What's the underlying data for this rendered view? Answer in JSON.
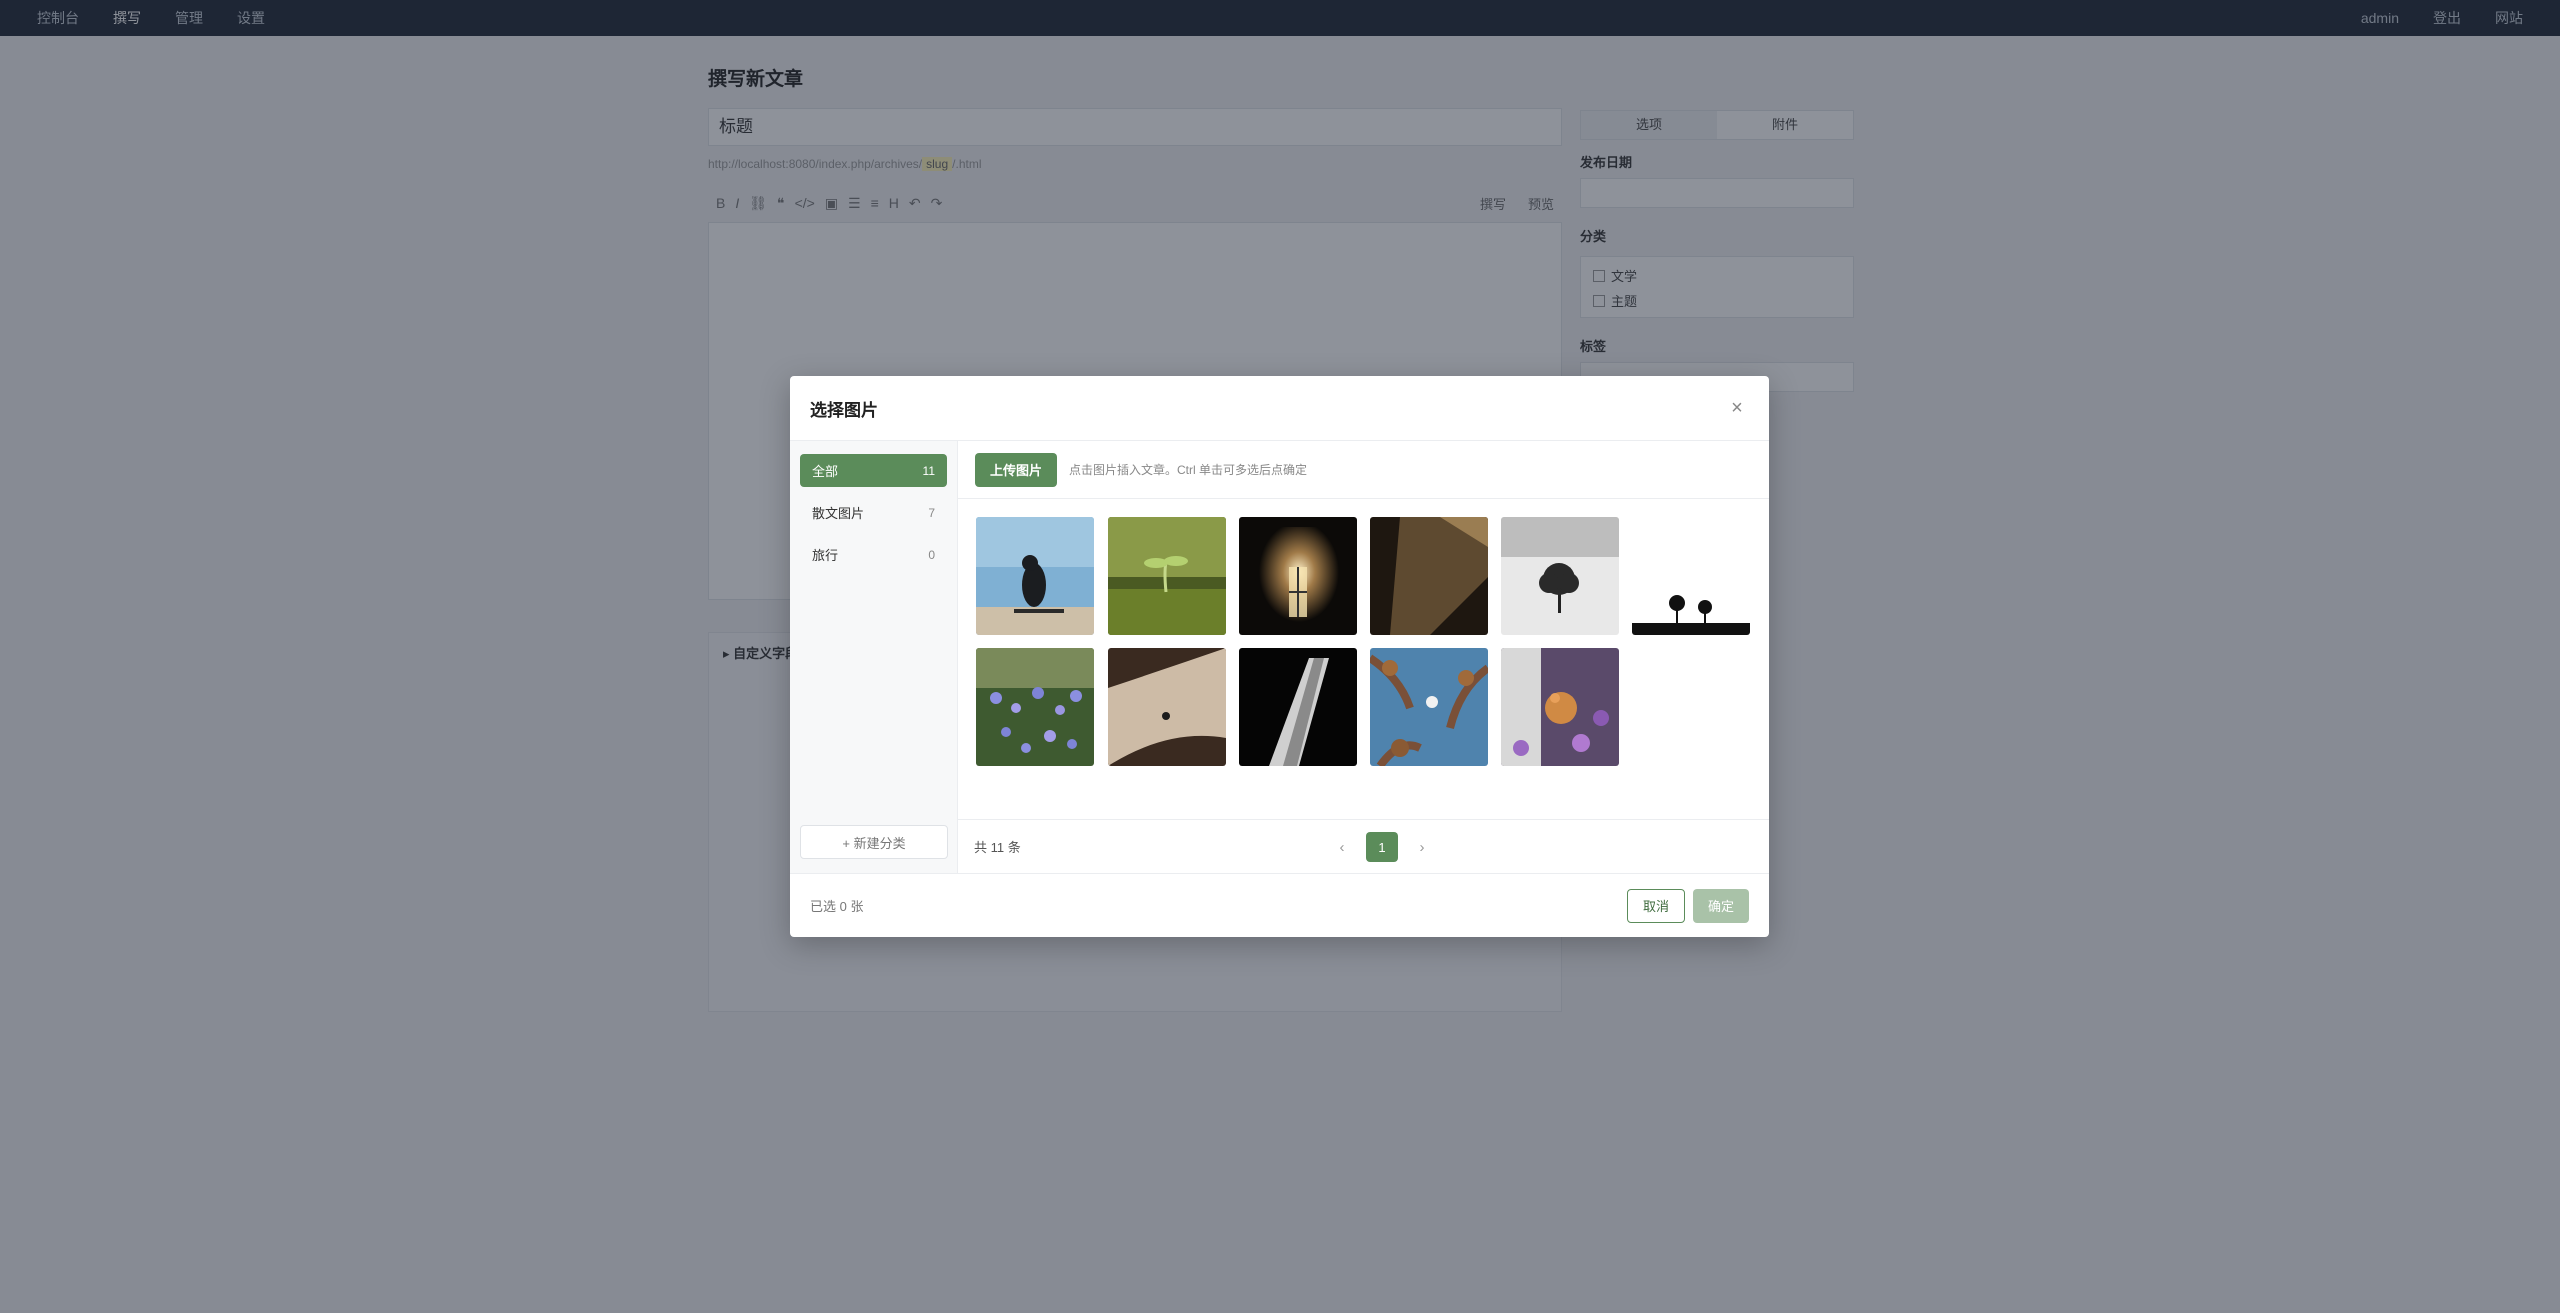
{
  "topnav": {
    "left": [
      "控制台",
      "撰写",
      "管理",
      "设置"
    ],
    "active_index": 1,
    "right": [
      "admin",
      "登出",
      "网站"
    ]
  },
  "editor": {
    "page_title": "撰写新文章",
    "title_placeholder": "标题",
    "url_prefix": "http://localhost:8080/index.php/archives/",
    "url_slug": "slug",
    "url_suffix": "/.html",
    "toolbar_right": [
      "撰写",
      "预览"
    ],
    "custom_fields_label": "▸ 自定义字段",
    "side_tabs": [
      "选项",
      "附件"
    ],
    "publish_date_label": "发布日期",
    "category_label": "分类",
    "categories": [
      "文学",
      "主题"
    ],
    "tags_label": "标签"
  },
  "modal": {
    "title": "选择图片",
    "close_glyph": "×",
    "categories": [
      {
        "name": "全部",
        "count": "11"
      },
      {
        "name": "散文图片",
        "count": "7"
      },
      {
        "name": "旅行",
        "count": "0"
      }
    ],
    "active_category": 0,
    "new_category_label": "+ 新建分类",
    "upload_label": "上传图片",
    "hint": "点击图片插入文章。Ctrl 单击可多选后点确定",
    "thumbnails": [
      {
        "name": "seaside-reader",
        "colors": [
          "#6fa3c9",
          "#a9cde3",
          "#1d1f22"
        ]
      },
      {
        "name": "seedling",
        "colors": [
          "#7a8b3a",
          "#a8c060",
          "#3d4a1c"
        ]
      },
      {
        "name": "window-light",
        "colors": [
          "#0e0c0a",
          "#4a3d2e",
          "#f0d8a0"
        ]
      },
      {
        "name": "dark-stairs",
        "colors": [
          "#2a2117",
          "#7a5f3c",
          "#1a1510"
        ]
      },
      {
        "name": "lone-tree",
        "colors": [
          "#f2f2f2",
          "#8a8a8a",
          "#1d1d1d"
        ]
      },
      {
        "name": "tree-silhouettes",
        "colors": [
          "#ffffff",
          "#ffffff",
          "#111111"
        ]
      },
      {
        "name": "lavender-field",
        "colors": [
          "#3b4a6e",
          "#8a8fd6",
          "#5b7a3a"
        ]
      },
      {
        "name": "dusty-ride",
        "colors": [
          "#3a2e26",
          "#c9b8a6",
          "#6a4a36"
        ]
      },
      {
        "name": "dark-road",
        "colors": [
          "#050505",
          "#1a1a1a",
          "#bfbfbf"
        ]
      },
      {
        "name": "moon-branches",
        "colors": [
          "#4d7fa8",
          "#8a6a4a",
          "#3a2a1f"
        ]
      },
      {
        "name": "cat-flowers",
        "colors": [
          "#6e4c8a",
          "#c98a4a",
          "#3a3a30"
        ]
      }
    ],
    "total_label": "共 11 条",
    "page_prev": "‹",
    "page_current": "1",
    "page_next": "›",
    "selected_label": "已选 0 张",
    "cancel_label": "取消",
    "confirm_label": "确定"
  },
  "colors": {
    "accent": "#5b8c5a",
    "accent_disabled": "#a9c2a8",
    "topbar": "#1f2734"
  }
}
